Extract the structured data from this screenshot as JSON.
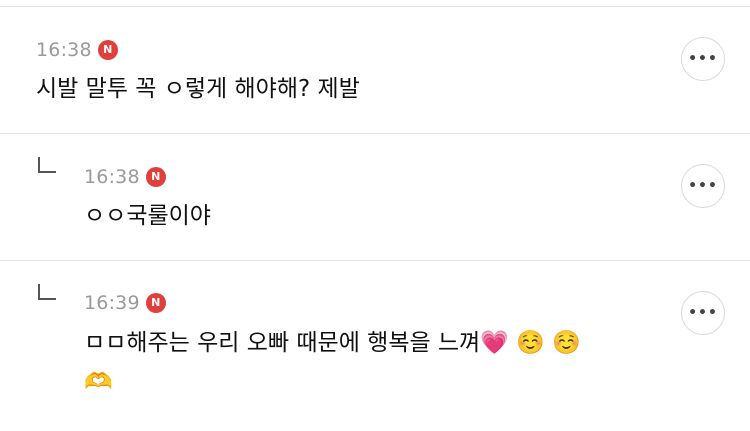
{
  "comments": [
    {
      "time": "16:38",
      "badge": "N",
      "text": "시발 말투 꼭 ㅇ렇게 해야해? 제발",
      "more": "•••"
    },
    {
      "time": "16:38",
      "badge": "N",
      "text": "ㅇㅇ국룰이야",
      "more": "•••"
    },
    {
      "time": "16:39",
      "badge": "N",
      "text_line1": "ㅁㅁ해주는 우리 오빠 때문에 행복을 느껴💗 ☺️ ☺️",
      "text_line2": "🫶",
      "more": "•••"
    }
  ]
}
